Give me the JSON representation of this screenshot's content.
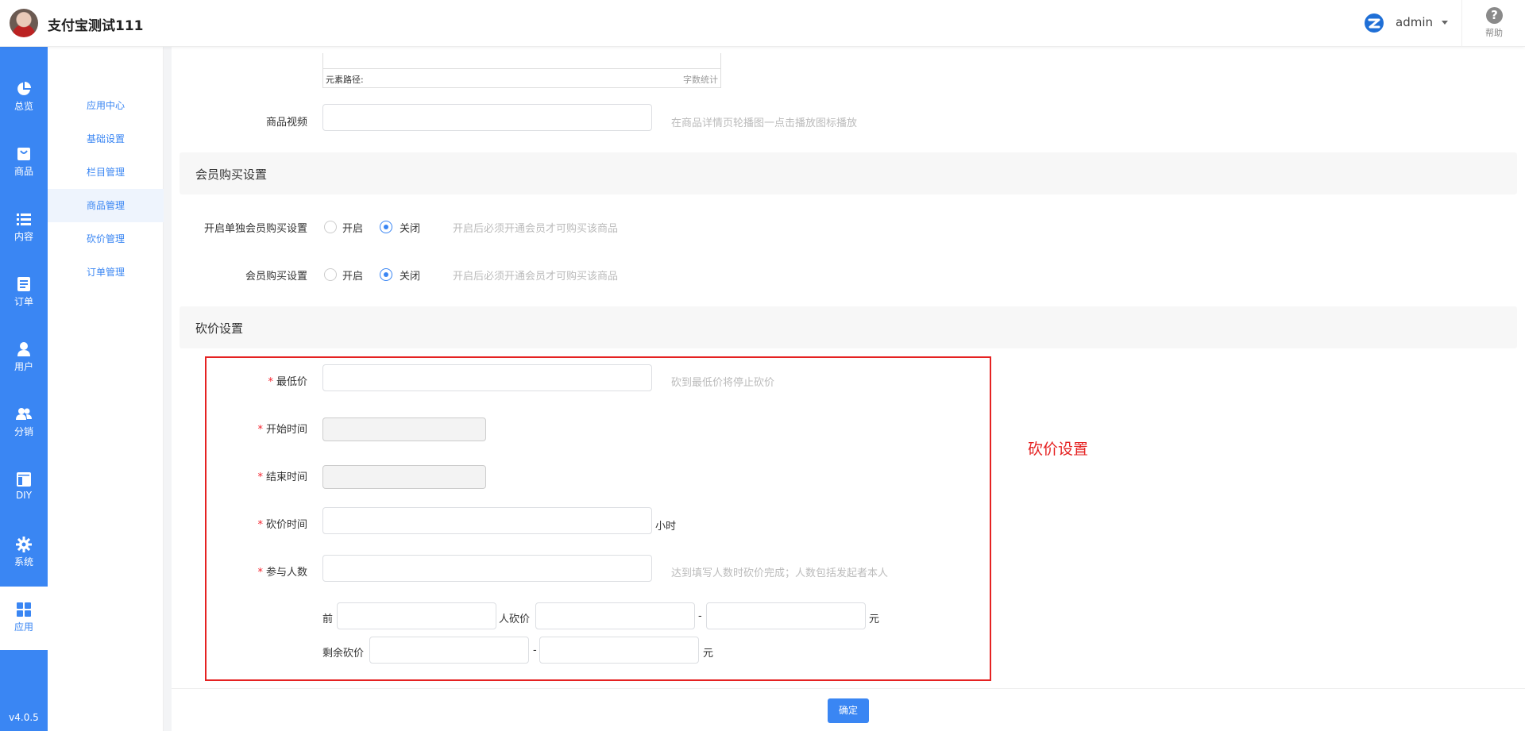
{
  "header": {
    "app_title": "支付宝测试111",
    "admin_name": "admin",
    "help_label": "帮助"
  },
  "leftnav": {
    "items": [
      {
        "label": "总览",
        "icon": "pie-chart-icon"
      },
      {
        "label": "商品",
        "icon": "shopping-bag-icon"
      },
      {
        "label": "内容",
        "icon": "list-icon"
      },
      {
        "label": "订单",
        "icon": "document-icon"
      },
      {
        "label": "用户",
        "icon": "user-icon"
      },
      {
        "label": "分销",
        "icon": "users-icon"
      },
      {
        "label": "DIY",
        "icon": "layout-icon"
      },
      {
        "label": "系统",
        "icon": "gear-icon"
      },
      {
        "label": "应用",
        "icon": "apps-grid-icon"
      }
    ],
    "active": "应用",
    "version": "v4.0.5"
  },
  "subnav": {
    "items": [
      "应用中心",
      "基础设置",
      "栏目管理",
      "商品管理",
      "砍价管理",
      "订单管理"
    ],
    "active": "商品管理"
  },
  "editor": {
    "path_label": "元素路径:",
    "count_label": "字数统计"
  },
  "video": {
    "label": "商品视频",
    "value": "",
    "hint": "在商品详情页轮播图一点击播放图标播放"
  },
  "member_section": {
    "title": "会员购买设置",
    "single_member": {
      "label": "开启单独会员购买设置",
      "on_label": "开启",
      "off_label": "关闭",
      "selected": "关闭",
      "hint": "开启后必须开通会员才可购买该商品"
    },
    "member_buy": {
      "label": "会员购买设置",
      "on_label": "开启",
      "off_label": "关闭",
      "selected": "关闭",
      "hint": "开启后必须开通会员才可购买该商品"
    }
  },
  "bargain_section": {
    "title": "砍价设置",
    "required_mark": "*",
    "min_price": {
      "label": "最低价",
      "value": "",
      "hint": "砍到最低价将停止砍价"
    },
    "start_time": {
      "label": "开始时间",
      "value": ""
    },
    "end_time": {
      "label": "结束时间",
      "value": ""
    },
    "bargain_time": {
      "label": "砍价时间",
      "value": "",
      "unit": "小时"
    },
    "participants": {
      "label": "参与人数",
      "value": "",
      "hint": "达到填写人数时砍价完成；人数包括发起者本人"
    },
    "first_row": {
      "prefix": "前",
      "middle": "人砍价",
      "dash": "-",
      "unit": "元"
    },
    "rest_row": {
      "prefix": "剩余砍价",
      "dash": "-",
      "unit": "元"
    }
  },
  "annotation": "砍价设置",
  "footer": {
    "confirm_label": "确定"
  },
  "colors": {
    "primary": "#3a86f3",
    "annotation_red": "#e52222"
  }
}
